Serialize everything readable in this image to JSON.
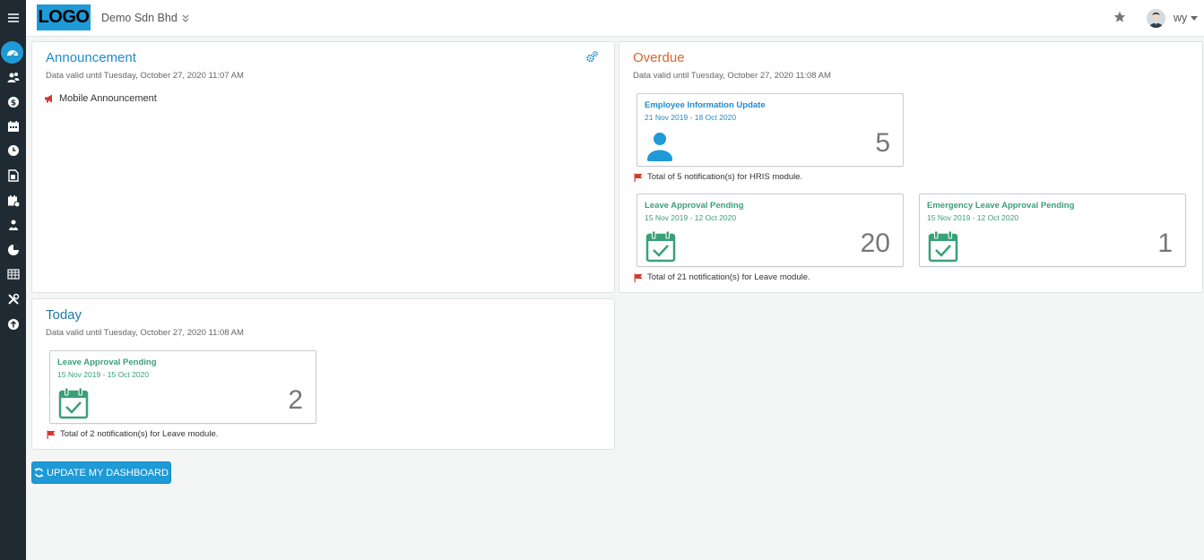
{
  "header": {
    "logo_text": "LOGO",
    "company": "Demo Sdn Bhd",
    "username": "wy"
  },
  "sidebar": {
    "items": [
      {
        "icon": "menu-icon"
      },
      {
        "icon": "dashboard-icon",
        "active": true
      },
      {
        "icon": "users-icon"
      },
      {
        "icon": "payroll-icon"
      },
      {
        "icon": "calendar-icon"
      },
      {
        "icon": "clock-icon"
      },
      {
        "icon": "document-icon"
      },
      {
        "icon": "schedule-icon"
      },
      {
        "icon": "claims-icon"
      },
      {
        "icon": "report-icon"
      },
      {
        "icon": "table-icon"
      },
      {
        "icon": "tools-icon"
      },
      {
        "icon": "upload-icon"
      }
    ]
  },
  "announcement": {
    "title": "Announcement",
    "valid": "Data valid until Tuesday, October 27, 2020 11:07 AM",
    "items": [
      "Mobile Announcement"
    ]
  },
  "overdue": {
    "title": "Overdue",
    "valid": "Data valid until Tuesday, October 27, 2020 11:08 AM",
    "cards": [
      {
        "title": "Employee Information Update",
        "date": "21 Nov 2019 - 18 Oct 2020",
        "count": "5",
        "icon": "person-icon"
      },
      {
        "title": "Leave Approval Pending",
        "date": "15 Nov 2019 - 12 Oct 2020",
        "count": "20",
        "icon": "calendar-check-icon"
      },
      {
        "title": "Emergency Leave Approval Pending",
        "date": "15 Nov 2019 - 12 Oct 2020",
        "count": "1",
        "icon": "calendar-check-icon"
      }
    ],
    "notes": [
      "Total of 5 notification(s) for HRIS module.",
      "Total of 21 notification(s) for Leave module."
    ]
  },
  "today": {
    "title": "Today",
    "valid": "Data valid until Tuesday, October 27, 2020 11:08 AM",
    "cards": [
      {
        "title": "Leave Approval Pending",
        "date": "15 Nov 2019 - 15 Oct 2020",
        "count": "2",
        "icon": "calendar-check-icon"
      }
    ],
    "notes": [
      "Total of 2 notification(s) for Leave module."
    ]
  },
  "actions": {
    "update_label": "UPDATE MY DASHBOARD"
  },
  "colors": {
    "accent": "#1e9ad6",
    "sidebar": "#1f2a33",
    "overdue_title": "#d9662b",
    "leave_green": "#3aa078"
  }
}
